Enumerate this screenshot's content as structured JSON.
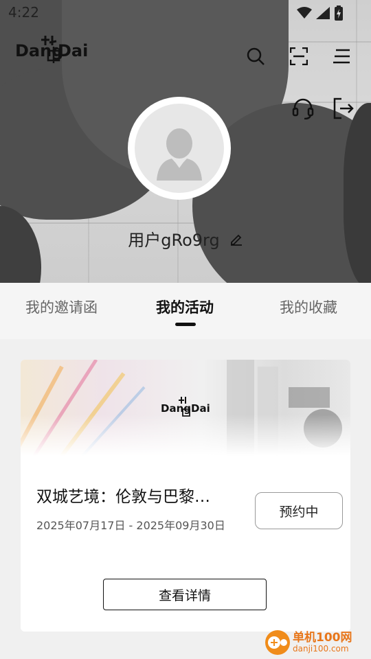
{
  "status_bar": {
    "time": "4:22"
  },
  "header": {
    "logo_text": "DangDai 北京"
  },
  "profile": {
    "username": "用户gRo9rg"
  },
  "tabs": [
    {
      "label": "我的邀请函",
      "active": false
    },
    {
      "label": "我的活动",
      "active": true
    },
    {
      "label": "我的收藏",
      "active": false
    }
  ],
  "activity_card": {
    "image_logo_text": "DangDai 北京",
    "title": "双城艺境：伦敦与巴黎…",
    "date_range": "2025年07月17日 - 2025年09月30日",
    "status_label": "预约中",
    "detail_button_label": "查看详情"
  },
  "watermark": {
    "name": "单机100网",
    "url": "danji100.com"
  },
  "colors": {
    "accent": "#111111",
    "watermark": "#e8761a"
  }
}
